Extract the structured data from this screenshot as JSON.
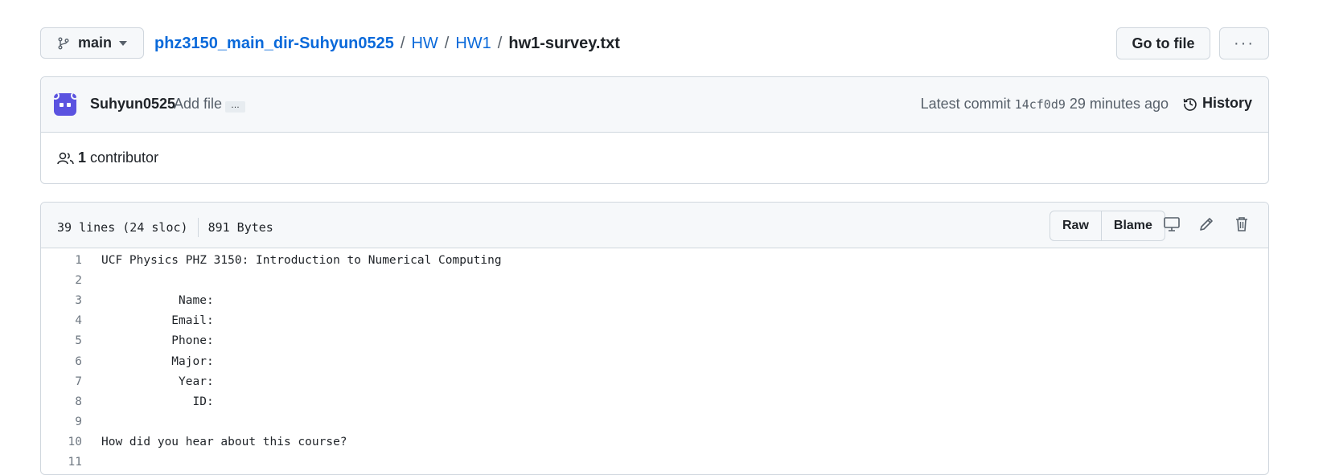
{
  "branch": {
    "name": "main"
  },
  "breadcrumb": {
    "repo": "phz3150_main_dir-Suhyun0525",
    "dir1": "HW",
    "dir2": "HW1",
    "file": "hw1-survey.txt",
    "separator": "/"
  },
  "actions": {
    "goto_file": "Go to file",
    "more": "···"
  },
  "commit": {
    "author": "Suhyun0525",
    "message": "Add file",
    "ellipsis": "…",
    "latest_label": "Latest commit",
    "sha": "14cf0d9",
    "time": "29 minutes ago",
    "history_label": "History"
  },
  "contributors": {
    "count": "1",
    "label": "contributor"
  },
  "file": {
    "lines_info": "39 lines (24 sloc)",
    "size": "891 Bytes",
    "raw_label": "Raw",
    "blame_label": "Blame"
  },
  "code_lines": [
    {
      "n": "1",
      "text": "UCF Physics PHZ 3150: Introduction to Numerical Computing"
    },
    {
      "n": "2",
      "text": ""
    },
    {
      "n": "3",
      "text": "           Name:"
    },
    {
      "n": "4",
      "text": "          Email:"
    },
    {
      "n": "5",
      "text": "          Phone:"
    },
    {
      "n": "6",
      "text": "          Major:"
    },
    {
      "n": "7",
      "text": "           Year:"
    },
    {
      "n": "8",
      "text": "             ID:"
    },
    {
      "n": "9",
      "text": ""
    },
    {
      "n": "10",
      "text": "How did you hear about this course?"
    },
    {
      "n": "11",
      "text": ""
    }
  ],
  "colors": {
    "link": "#0969da",
    "muted": "#57606a",
    "border": "#d0d7de",
    "header_bg": "#f6f8fa",
    "avatar": "#5b53e0"
  },
  "icons": [
    "git-branch-icon",
    "caret-down-icon",
    "history-icon",
    "people-icon",
    "desktop-icon",
    "pencil-icon",
    "trash-icon"
  ]
}
